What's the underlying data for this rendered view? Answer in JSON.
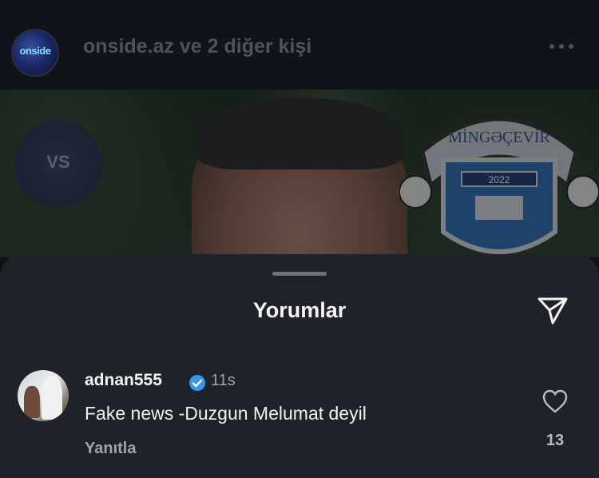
{
  "header": {
    "account_avatar_text": "onside",
    "title_account": "onside.az",
    "title_rest": "ve 2 diğer kişi"
  },
  "photo": {
    "crest_top_text": "MİNGƏÇEVİR",
    "crest_year": "2022",
    "vs_text": "VS"
  },
  "comments_sheet": {
    "title": "Yorumlar",
    "comments": [
      {
        "username": "adnan555",
        "verified": true,
        "time": "11s",
        "text": "Fake news -Duzgun Melumat deyil",
        "reply_label": "Yanıtla",
        "likes": "13"
      }
    ]
  },
  "colors": {
    "sheet_bg": "#1f2229",
    "verified_blue": "#3797f0",
    "muted_text": "#9ea3ad"
  }
}
